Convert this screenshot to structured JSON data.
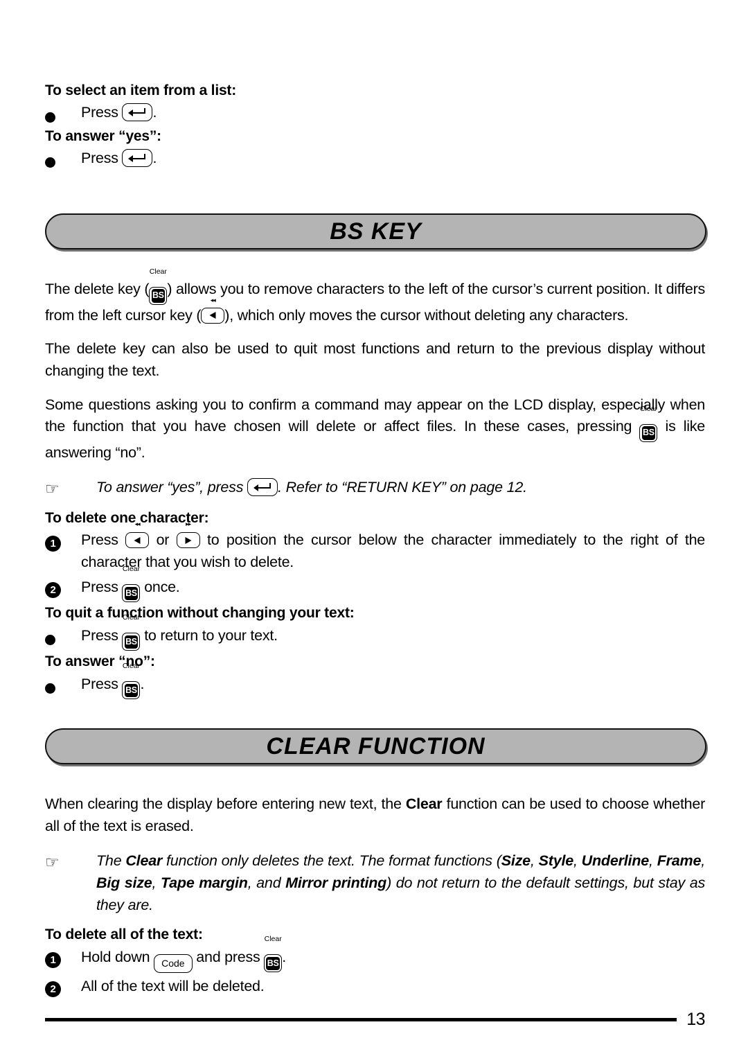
{
  "page": {
    "number": "13",
    "banner_fill": "#b4b4b4",
    "text_color": "#000000"
  },
  "keys": {
    "bs": {
      "glyph": "BS",
      "cap_label": "Clear",
      "name": "bs-key"
    },
    "cursor_left": {
      "marks": "◂◂",
      "name": "left-cursor-key"
    },
    "cursor_right": {
      "marks": "▸▸",
      "name": "right-cursor-key"
    },
    "return": {
      "name": "return-key"
    },
    "code": {
      "glyph": "Code",
      "name": "code-key"
    }
  },
  "icons": {
    "pointing_hand": "☞"
  },
  "top_section": {
    "heading_1": "To select an item from a list:",
    "item_1_pre": "Press",
    "item_1_post": ".",
    "heading_2": "To answer “yes”:",
    "item_2_pre": "Press",
    "item_2_post": "."
  },
  "section_bs": {
    "banner_title": "BS KEY",
    "para_1_a": "The delete key (",
    "para_1_b": ") allows you to remove characters to the left of the cursor’s current position. It differs from the left cursor key (",
    "para_1_c": "), which only moves the cursor without deleting any characters.",
    "para_2": "The delete key can also be used to quit most functions and return to the previous display without changing the text.",
    "para_3_a": "Some questions asking you to confirm a command may appear on the LCD display, especially when the function that you have chosen will delete or affect files. In these cases, pressing",
    "para_3_b": "is like answering “no”.",
    "note_a": "To answer “yes”, press",
    "note_b": ". Refer to “RETURN KEY” on page 12.",
    "heading_delete_one": "To delete one character:",
    "step_1_num": "1",
    "step_1_a": "Press",
    "step_1_b": "or",
    "step_1_c": "to position the cursor below the character immediately to the right of the character that you wish to delete.",
    "step_2_num": "2",
    "step_2_a": "Press",
    "step_2_b": "once.",
    "heading_quit": "To quit a function without changing your text:",
    "quit_item_a": "Press",
    "quit_item_b": "to return to your text.",
    "heading_answer_no": "To answer “no”:",
    "no_item_a": "Press",
    "no_item_b": "."
  },
  "section_clear": {
    "banner_title": "CLEAR FUNCTION",
    "para_1_a": "When clearing the display before entering new text, the ",
    "para_1_bold": "Clear",
    "para_1_b": " function can be used to choose whether all of the text is erased.",
    "note": {
      "t1": "The ",
      "b1": "Clear",
      "t2": " function only deletes the text. The format functions (",
      "b2": "Size",
      "t3": ", ",
      "b3": "Style",
      "t4": ", ",
      "b4": "Underline",
      "t5": ", ",
      "b5": "Frame",
      "t6": ", ",
      "b6": "Big size",
      "t7": ", ",
      "b7": "Tape margin",
      "t8": ", and ",
      "b8": "Mirror printing",
      "t9": ") do not return to the default settings, but stay as they are."
    },
    "heading_delete_all": "To delete all of the text:",
    "step_1_num": "1",
    "step_1_a": "Hold down",
    "step_1_b": "and press",
    "step_1_c": ".",
    "step_2_num": "2",
    "step_2_text": "All of the text will be deleted."
  }
}
